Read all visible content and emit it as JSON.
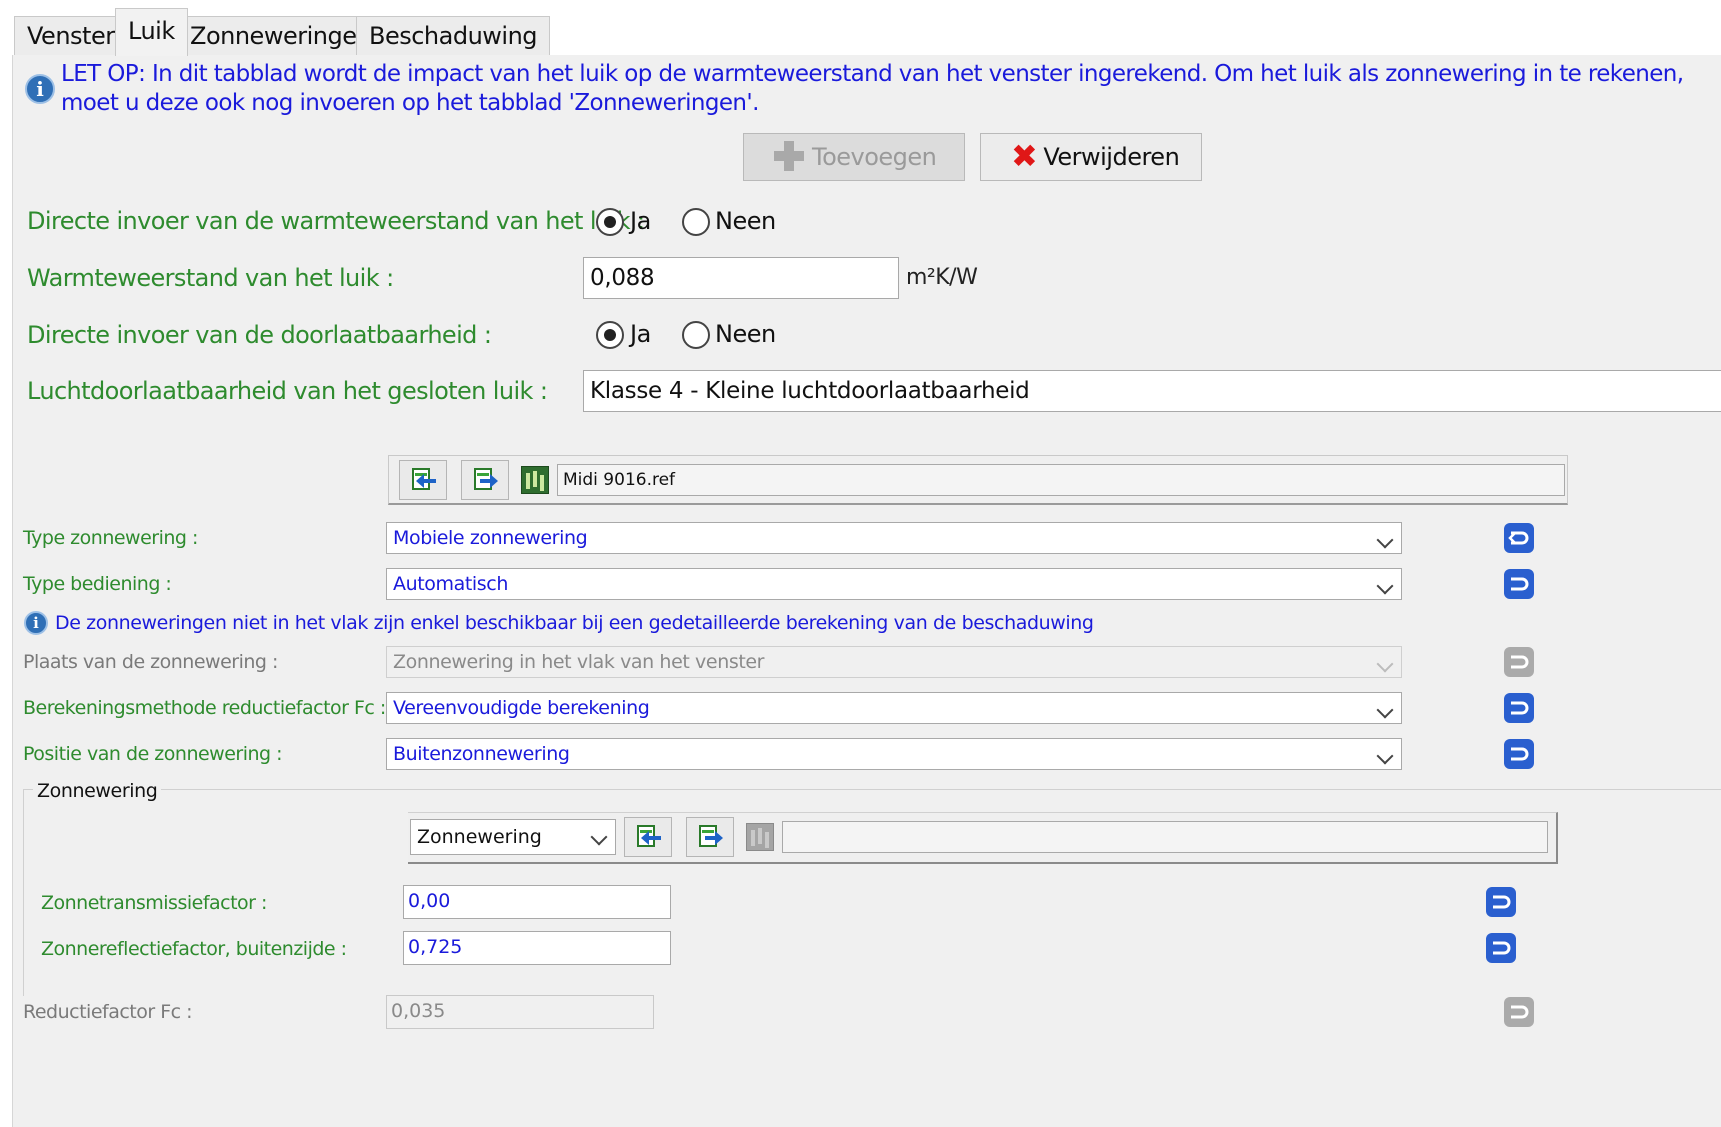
{
  "tabs": [
    {
      "label": "Venster",
      "active": false
    },
    {
      "label": "Luik",
      "active": true
    },
    {
      "label": "Zonneweringen",
      "active": false
    },
    {
      "label": "Beschaduwing",
      "active": false
    }
  ],
  "luik": {
    "info_line1": "LET OP: In dit tabblad wordt de impact van het luik op de warmteweerstand van het venster ingerekend. Om het luik als zonnewering in te rekenen,",
    "info_line2": "moet u deze ook nog invoeren op het tabblad 'Zonneweringen'.",
    "add_label": "Toevoegen",
    "remove_label": "Verwijderen",
    "direct_thermal_label": "Directe invoer van de warmteweerstand van het luik :",
    "yes_label": "Ja",
    "no_label": "Neen",
    "direct_thermal_selected": "Ja",
    "thermal_resistance_label": "Warmteweerstand van het luik :",
    "thermal_resistance_value": "0,088",
    "thermal_resistance_unit": "m²K/W",
    "direct_permeability_label": "Directe invoer van de doorlaatbaarheid :",
    "direct_permeability_selected": "Ja",
    "air_permeability_label": "Luchtdoorlaatbaarheid van het gesloten luik :",
    "air_permeability_value": "Klasse 4 - Kleine luchtdoorlaatbaarheid"
  },
  "zonnewering": {
    "library_file": "Midi 9016.ref",
    "type_label": "Type zonnewering :",
    "type_value": "Mobiele zonnewering",
    "control_label": "Type bediening :",
    "control_value": "Automatisch",
    "info_note": "De zonneweringen niet in het vlak zijn enkel beschikbaar bij een gedetailleerde berekening van de beschaduwing",
    "place_label": "Plaats van de zonnewering :",
    "place_value": "Zonnewering in het vlak van het venster",
    "method_label": "Berekeningsmethode reductiefactor Fc :",
    "method_value": "Vereenvoudigde berekening",
    "position_label": "Positie van de zonnewering :",
    "position_value": "Buitenzonnewering",
    "group_title": "Zonnewering",
    "group_combo_value": "Zonnewering",
    "transmission_label": "Zonnetransmissiefactor :",
    "transmission_value": "0,00",
    "reflection_label": "Zonnereflectiefactor, buitenzijde :",
    "reflection_value": "0,725",
    "reduction_label": "Reductiefactor Fc :",
    "reduction_value": "0,035"
  },
  "colors": {
    "label_green": "#2e8b2e",
    "value_blue": "#1a1adb",
    "undo_blue": "#2a5fcf",
    "delete_red": "#e01717"
  },
  "icons": [
    "info-icon",
    "plus-icon",
    "delete-x-icon",
    "import-icon",
    "export-icon",
    "library-icon",
    "chevron-down-icon",
    "undo-icon"
  ]
}
